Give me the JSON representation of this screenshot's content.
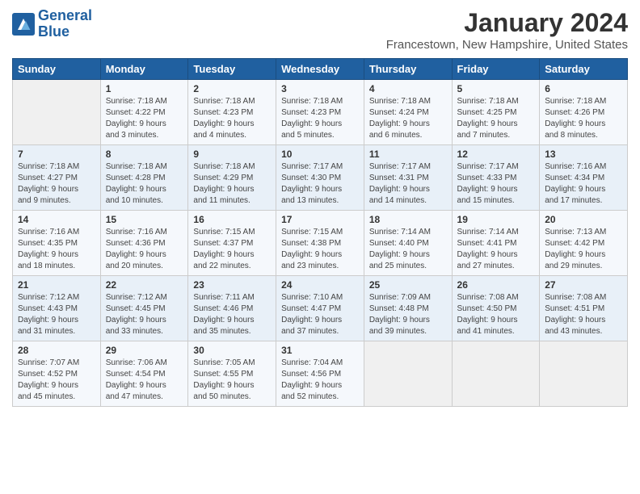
{
  "logo": {
    "line1": "General",
    "line2": "Blue"
  },
  "title": "January 2024",
  "location": "Francestown, New Hampshire, United States",
  "days_header": [
    "Sunday",
    "Monday",
    "Tuesday",
    "Wednesday",
    "Thursday",
    "Friday",
    "Saturday"
  ],
  "weeks": [
    [
      {
        "num": "",
        "sunrise": "",
        "sunset": "",
        "daylight": ""
      },
      {
        "num": "1",
        "sunrise": "Sunrise: 7:18 AM",
        "sunset": "Sunset: 4:22 PM",
        "daylight": "Daylight: 9 hours and 3 minutes."
      },
      {
        "num": "2",
        "sunrise": "Sunrise: 7:18 AM",
        "sunset": "Sunset: 4:23 PM",
        "daylight": "Daylight: 9 hours and 4 minutes."
      },
      {
        "num": "3",
        "sunrise": "Sunrise: 7:18 AM",
        "sunset": "Sunset: 4:23 PM",
        "daylight": "Daylight: 9 hours and 5 minutes."
      },
      {
        "num": "4",
        "sunrise": "Sunrise: 7:18 AM",
        "sunset": "Sunset: 4:24 PM",
        "daylight": "Daylight: 9 hours and 6 minutes."
      },
      {
        "num": "5",
        "sunrise": "Sunrise: 7:18 AM",
        "sunset": "Sunset: 4:25 PM",
        "daylight": "Daylight: 9 hours and 7 minutes."
      },
      {
        "num": "6",
        "sunrise": "Sunrise: 7:18 AM",
        "sunset": "Sunset: 4:26 PM",
        "daylight": "Daylight: 9 hours and 8 minutes."
      }
    ],
    [
      {
        "num": "7",
        "sunrise": "Sunrise: 7:18 AM",
        "sunset": "Sunset: 4:27 PM",
        "daylight": "Daylight: 9 hours and 9 minutes."
      },
      {
        "num": "8",
        "sunrise": "Sunrise: 7:18 AM",
        "sunset": "Sunset: 4:28 PM",
        "daylight": "Daylight: 9 hours and 10 minutes."
      },
      {
        "num": "9",
        "sunrise": "Sunrise: 7:18 AM",
        "sunset": "Sunset: 4:29 PM",
        "daylight": "Daylight: 9 hours and 11 minutes."
      },
      {
        "num": "10",
        "sunrise": "Sunrise: 7:17 AM",
        "sunset": "Sunset: 4:30 PM",
        "daylight": "Daylight: 9 hours and 13 minutes."
      },
      {
        "num": "11",
        "sunrise": "Sunrise: 7:17 AM",
        "sunset": "Sunset: 4:31 PM",
        "daylight": "Daylight: 9 hours and 14 minutes."
      },
      {
        "num": "12",
        "sunrise": "Sunrise: 7:17 AM",
        "sunset": "Sunset: 4:33 PM",
        "daylight": "Daylight: 9 hours and 15 minutes."
      },
      {
        "num": "13",
        "sunrise": "Sunrise: 7:16 AM",
        "sunset": "Sunset: 4:34 PM",
        "daylight": "Daylight: 9 hours and 17 minutes."
      }
    ],
    [
      {
        "num": "14",
        "sunrise": "Sunrise: 7:16 AM",
        "sunset": "Sunset: 4:35 PM",
        "daylight": "Daylight: 9 hours and 18 minutes."
      },
      {
        "num": "15",
        "sunrise": "Sunrise: 7:16 AM",
        "sunset": "Sunset: 4:36 PM",
        "daylight": "Daylight: 9 hours and 20 minutes."
      },
      {
        "num": "16",
        "sunrise": "Sunrise: 7:15 AM",
        "sunset": "Sunset: 4:37 PM",
        "daylight": "Daylight: 9 hours and 22 minutes."
      },
      {
        "num": "17",
        "sunrise": "Sunrise: 7:15 AM",
        "sunset": "Sunset: 4:38 PM",
        "daylight": "Daylight: 9 hours and 23 minutes."
      },
      {
        "num": "18",
        "sunrise": "Sunrise: 7:14 AM",
        "sunset": "Sunset: 4:40 PM",
        "daylight": "Daylight: 9 hours and 25 minutes."
      },
      {
        "num": "19",
        "sunrise": "Sunrise: 7:14 AM",
        "sunset": "Sunset: 4:41 PM",
        "daylight": "Daylight: 9 hours and 27 minutes."
      },
      {
        "num": "20",
        "sunrise": "Sunrise: 7:13 AM",
        "sunset": "Sunset: 4:42 PM",
        "daylight": "Daylight: 9 hours and 29 minutes."
      }
    ],
    [
      {
        "num": "21",
        "sunrise": "Sunrise: 7:12 AM",
        "sunset": "Sunset: 4:43 PM",
        "daylight": "Daylight: 9 hours and 31 minutes."
      },
      {
        "num": "22",
        "sunrise": "Sunrise: 7:12 AM",
        "sunset": "Sunset: 4:45 PM",
        "daylight": "Daylight: 9 hours and 33 minutes."
      },
      {
        "num": "23",
        "sunrise": "Sunrise: 7:11 AM",
        "sunset": "Sunset: 4:46 PM",
        "daylight": "Daylight: 9 hours and 35 minutes."
      },
      {
        "num": "24",
        "sunrise": "Sunrise: 7:10 AM",
        "sunset": "Sunset: 4:47 PM",
        "daylight": "Daylight: 9 hours and 37 minutes."
      },
      {
        "num": "25",
        "sunrise": "Sunrise: 7:09 AM",
        "sunset": "Sunset: 4:48 PM",
        "daylight": "Daylight: 9 hours and 39 minutes."
      },
      {
        "num": "26",
        "sunrise": "Sunrise: 7:08 AM",
        "sunset": "Sunset: 4:50 PM",
        "daylight": "Daylight: 9 hours and 41 minutes."
      },
      {
        "num": "27",
        "sunrise": "Sunrise: 7:08 AM",
        "sunset": "Sunset: 4:51 PM",
        "daylight": "Daylight: 9 hours and 43 minutes."
      }
    ],
    [
      {
        "num": "28",
        "sunrise": "Sunrise: 7:07 AM",
        "sunset": "Sunset: 4:52 PM",
        "daylight": "Daylight: 9 hours and 45 minutes."
      },
      {
        "num": "29",
        "sunrise": "Sunrise: 7:06 AM",
        "sunset": "Sunset: 4:54 PM",
        "daylight": "Daylight: 9 hours and 47 minutes."
      },
      {
        "num": "30",
        "sunrise": "Sunrise: 7:05 AM",
        "sunset": "Sunset: 4:55 PM",
        "daylight": "Daylight: 9 hours and 50 minutes."
      },
      {
        "num": "31",
        "sunrise": "Sunrise: 7:04 AM",
        "sunset": "Sunset: 4:56 PM",
        "daylight": "Daylight: 9 hours and 52 minutes."
      },
      {
        "num": "",
        "sunrise": "",
        "sunset": "",
        "daylight": ""
      },
      {
        "num": "",
        "sunrise": "",
        "sunset": "",
        "daylight": ""
      },
      {
        "num": "",
        "sunrise": "",
        "sunset": "",
        "daylight": ""
      }
    ]
  ]
}
